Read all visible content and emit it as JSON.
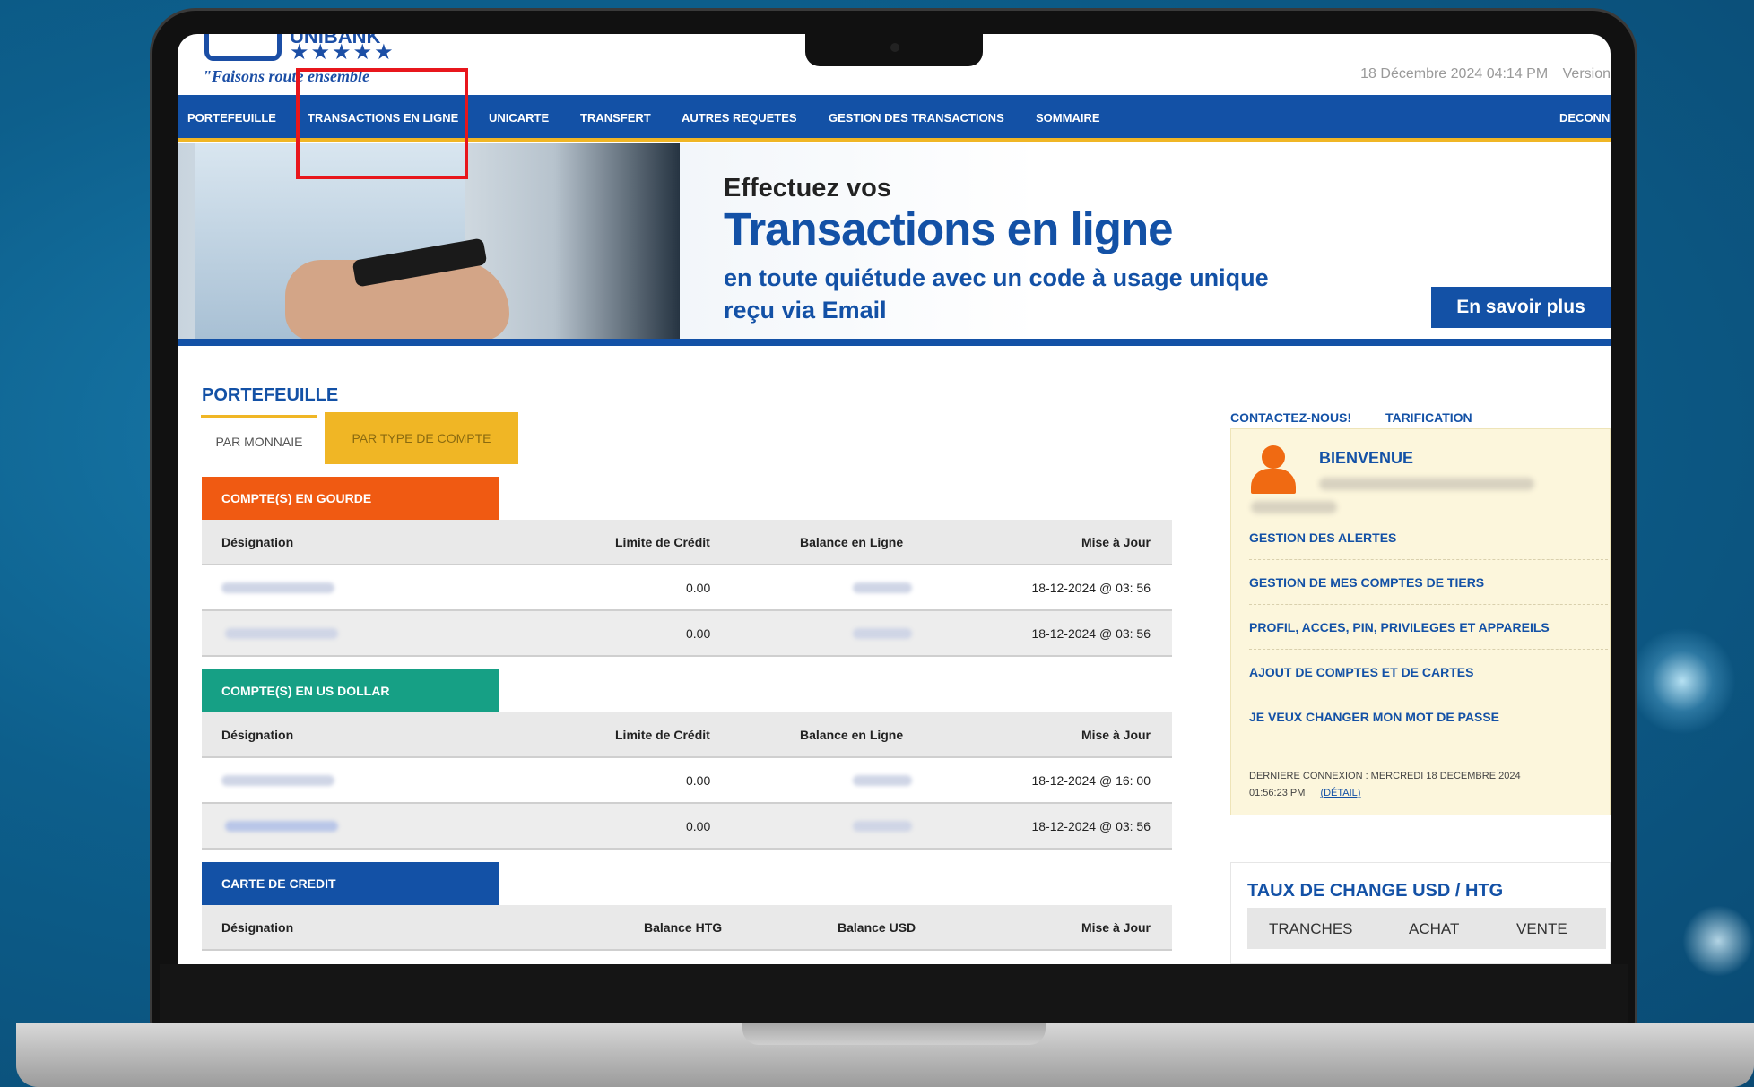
{
  "header": {
    "logo_name": "UNIBANK",
    "logo_stars": "★★★★★",
    "slogan": "\"Faisons route ensemble",
    "datetime": "18 Décembre 2024 04:14 PM",
    "version_label": "Version"
  },
  "nav": {
    "items": [
      {
        "label": "PORTEFEUILLE"
      },
      {
        "label": "TRANSACTIONS EN LIGNE"
      },
      {
        "label": "UNICARTE"
      },
      {
        "label": "TRANSFERT"
      },
      {
        "label": "AUTRES REQUETES"
      },
      {
        "label": "GESTION DES TRANSACTIONS"
      },
      {
        "label": "SOMMAIRE"
      }
    ],
    "logout": "DECONN"
  },
  "banner": {
    "line1": "Effectuez vos",
    "line2": "Transactions en ligne",
    "line3": "en toute quiétude avec un code à usage unique",
    "line4": "reçu via Email",
    "button": "En savoir plus"
  },
  "portfolio": {
    "title": "PORTEFEUILLE",
    "tabs": [
      "PAR MONNAIE",
      "PAR TYPE DE COMPTE"
    ],
    "accounts_gourde": {
      "header": "COMPTE(S) EN GOURDE",
      "color": "#f05a12",
      "columns": [
        "Désignation",
        "Limite de Crédit",
        "Balance en Ligne",
        "Mise à Jour"
      ],
      "rows": [
        {
          "limit": "0.00",
          "updated": "18-12-2024 @ 03: 56"
        },
        {
          "limit": "0.00",
          "updated": "18-12-2024 @ 03: 56"
        }
      ]
    },
    "accounts_usd": {
      "header": "COMPTE(S) EN US DOLLAR",
      "color": "#16a085",
      "columns": [
        "Désignation",
        "Limite de Crédit",
        "Balance en Ligne",
        "Mise à Jour"
      ],
      "rows": [
        {
          "limit": "0.00",
          "updated": "18-12-2024 @ 16: 00"
        },
        {
          "limit": "0.00",
          "updated": "18-12-2024 @ 03: 56"
        }
      ]
    },
    "credit_card": {
      "header": "CARTE DE CREDIT",
      "color": "#1351a6",
      "columns": [
        "Désignation",
        "Balance HTG",
        "Balance USD",
        "Mise à Jour"
      ]
    }
  },
  "sidebar": {
    "contact": "CONTACTEZ-NOUS!",
    "pricing": "TARIFICATION",
    "welcome": "BIENVENUE",
    "links": [
      "GESTION DES ALERTES",
      "GESTION DE MES COMPTES DE TIERS",
      "PROFIL, ACCES, PIN, PRIVILEGES ET APPAREILS",
      "AJOUT DE COMPTES ET DE CARTES",
      "JE VEUX CHANGER MON MOT DE PASSE"
    ],
    "last_login_line1": "DERNIERE CONNEXION : MERCREDI 18 DECEMBRE 2024",
    "last_login_line2": "01:56:23 PM",
    "detail_link": "(DÉTAIL)"
  },
  "exchange": {
    "title": "TAUX DE CHANGE USD / HTG",
    "columns": [
      "TRANCHES",
      "ACHAT",
      "VENTE"
    ]
  }
}
